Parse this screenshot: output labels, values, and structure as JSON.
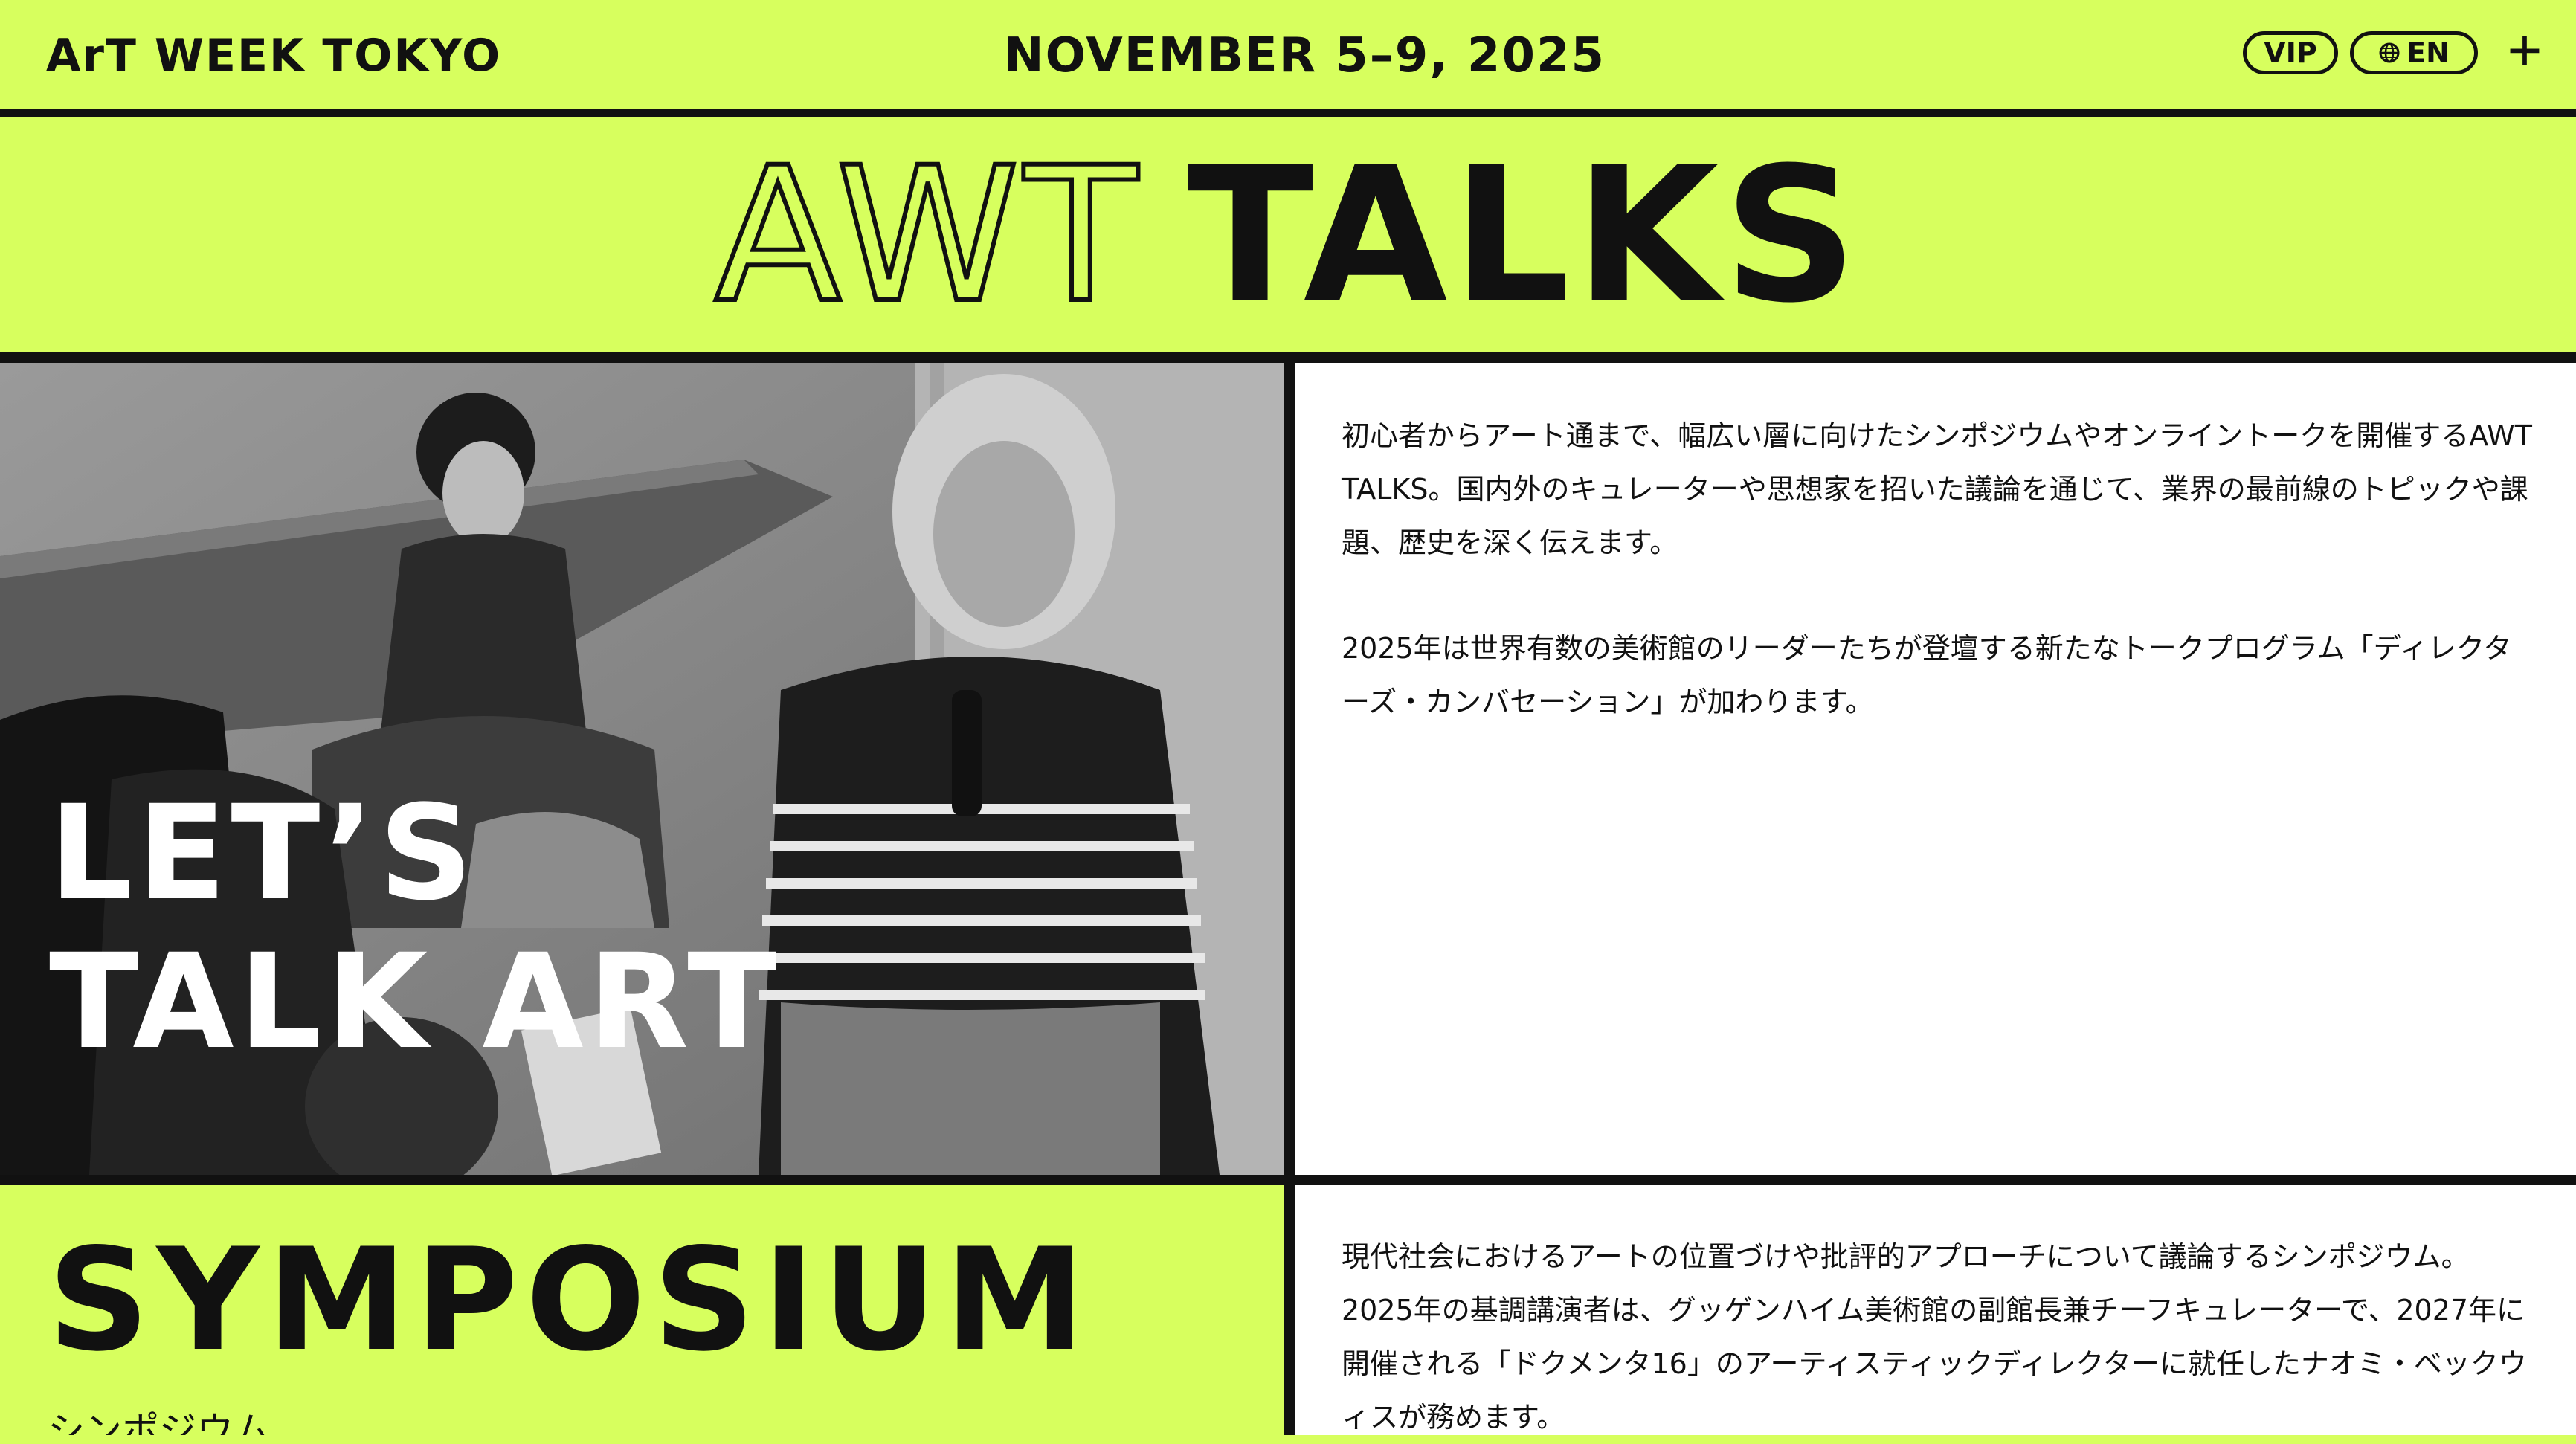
{
  "header": {
    "brand": "ArT WEEK TOKYO",
    "dates": "NOVEMBER 5–9, 2025",
    "vip_label": "VIP",
    "lang_label": "EN",
    "globe_icon": "globe-icon",
    "menu_icon": "plus-icon"
  },
  "hero": {
    "title_outline": "AWT",
    "title_solid": "TALKS"
  },
  "feature": {
    "overlay_line1": "LET’S",
    "overlay_line2": "TALK ART",
    "paragraph1": "初心者からアート通まで、幅広い層に向けたシンポジウムやオンライントークを開催するAWT TALKS。国内外のキュレーターや思想家を招いた議論を通じて、業界の最前線のトピックや課題、歴史を深く伝えます。",
    "paragraph2": "2025年は世界有数の美術館のリーダーたちが登壇する新たなトークプログラム「ディレクターズ・カンバセーション」が加わります。"
  },
  "symposium": {
    "title": "SYMPOSIUM",
    "subtitle": "シンポジウム",
    "paragraph": "現代社会におけるアートの位置づけや批評的アプローチについて議論するシンポジウム。2025年の基調講演者は、グッゲンハイム美術館の副館長兼チーフキュレーターで、2027年に開催される「ドクメンタ16」のアーティスティックディレクターに就任したナオミ・ベックウィスが務めます。"
  },
  "colors": {
    "accent": "#d7ff5e",
    "ink": "#111111",
    "panel": "#ffffff"
  }
}
